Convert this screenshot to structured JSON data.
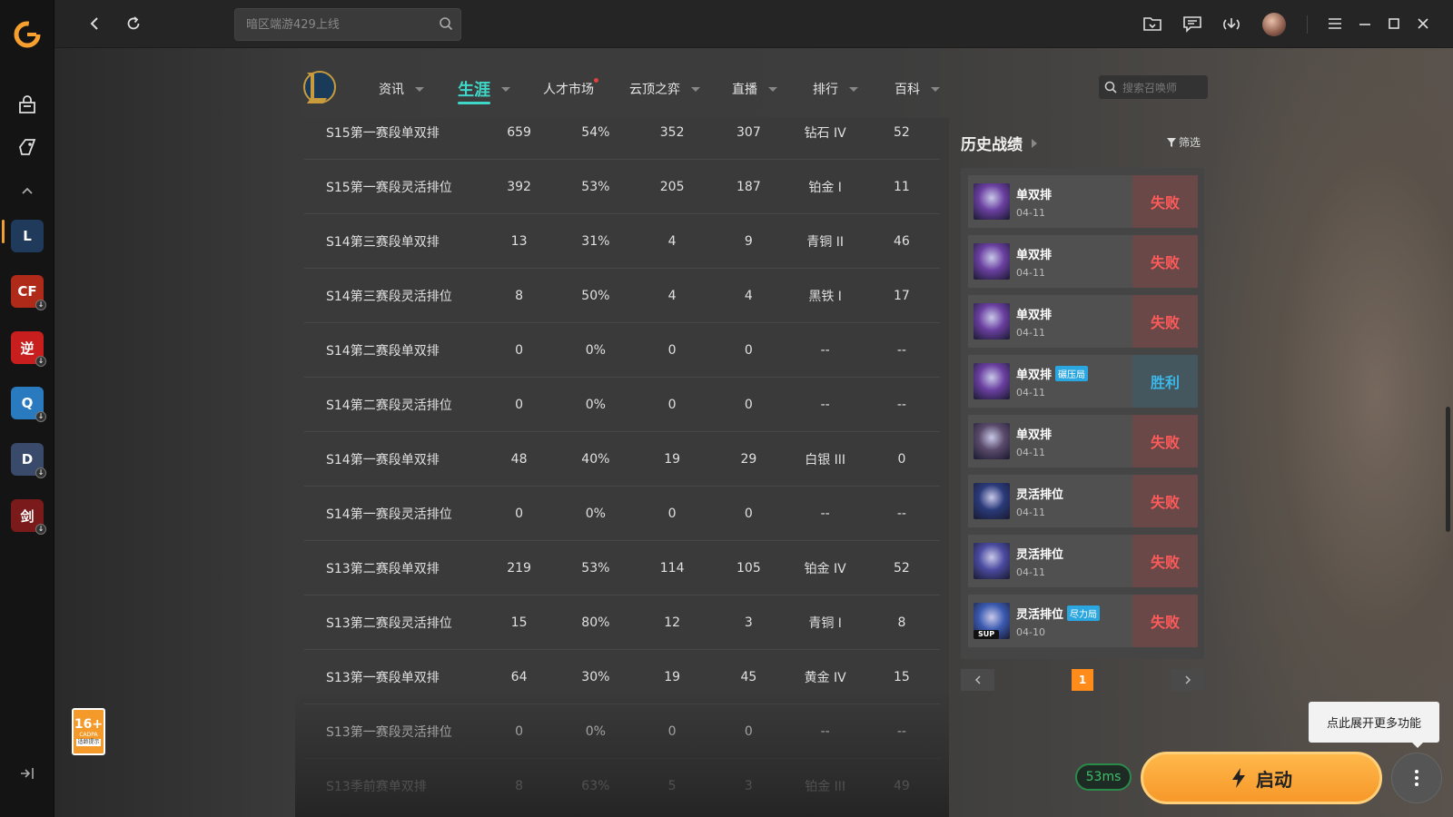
{
  "search": {
    "placeholder": "暗区端游429上线"
  },
  "nav": {
    "items": [
      {
        "label": "资讯"
      },
      {
        "label": "生涯"
      },
      {
        "label": "人才市场"
      },
      {
        "label": "云顶之弈"
      },
      {
        "label": "直播"
      },
      {
        "label": "排行"
      },
      {
        "label": "百科"
      }
    ],
    "summoner_placeholder": "搜索召唤师"
  },
  "stats_rows": [
    {
      "season": "S15第一赛段单双排",
      "games": "659",
      "winrate": "54%",
      "wins": "352",
      "losses": "307",
      "rank": "钻石 IV",
      "lp": "52"
    },
    {
      "season": "S15第一赛段灵活排位",
      "games": "392",
      "winrate": "53%",
      "wins": "205",
      "losses": "187",
      "rank": "铂金 I",
      "lp": "11"
    },
    {
      "season": "S14第三赛段单双排",
      "games": "13",
      "winrate": "31%",
      "wins": "4",
      "losses": "9",
      "rank": "青铜 II",
      "lp": "46"
    },
    {
      "season": "S14第三赛段灵活排位",
      "games": "8",
      "winrate": "50%",
      "wins": "4",
      "losses": "4",
      "rank": "黑铁 I",
      "lp": "17"
    },
    {
      "season": "S14第二赛段单双排",
      "games": "0",
      "winrate": "0%",
      "wins": "0",
      "losses": "0",
      "rank": "--",
      "lp": "--"
    },
    {
      "season": "S14第二赛段灵活排位",
      "games": "0",
      "winrate": "0%",
      "wins": "0",
      "losses": "0",
      "rank": "--",
      "lp": "--"
    },
    {
      "season": "S14第一赛段单双排",
      "games": "48",
      "winrate": "40%",
      "wins": "19",
      "losses": "29",
      "rank": "白银 III",
      "lp": "0"
    },
    {
      "season": "S14第一赛段灵活排位",
      "games": "0",
      "winrate": "0%",
      "wins": "0",
      "losses": "0",
      "rank": "--",
      "lp": "--"
    },
    {
      "season": "S13第二赛段单双排",
      "games": "219",
      "winrate": "53%",
      "wins": "114",
      "losses": "105",
      "rank": "铂金 IV",
      "lp": "52"
    },
    {
      "season": "S13第二赛段灵活排位",
      "games": "15",
      "winrate": "80%",
      "wins": "12",
      "losses": "3",
      "rank": "青铜 I",
      "lp": "8"
    },
    {
      "season": "S13第一赛段单双排",
      "games": "64",
      "winrate": "30%",
      "wins": "19",
      "losses": "45",
      "rank": "黄金 IV",
      "lp": "15"
    },
    {
      "season": "S13第一赛段灵活排位",
      "games": "0",
      "winrate": "0%",
      "wins": "0",
      "losses": "0",
      "rank": "--",
      "lp": "--"
    },
    {
      "season": "S13季前赛单双排",
      "games": "8",
      "winrate": "63%",
      "wins": "5",
      "losses": "3",
      "rank": "铂金 III",
      "lp": "49"
    }
  ],
  "history": {
    "title": "历史战绩",
    "filter_label": "筛选",
    "matches": [
      {
        "mode": "单双排",
        "tag": "",
        "date": "04-11",
        "result": "失败",
        "outcome": "lose",
        "champ_color": "#6a3fa0",
        "support": ""
      },
      {
        "mode": "单双排",
        "tag": "",
        "date": "04-11",
        "result": "失败",
        "outcome": "lose",
        "champ_color": "#6a3fa0",
        "support": ""
      },
      {
        "mode": "单双排",
        "tag": "",
        "date": "04-11",
        "result": "失败",
        "outcome": "lose",
        "champ_color": "#6a3fa0",
        "support": ""
      },
      {
        "mode": "单双排",
        "tag": "碾压局",
        "date": "04-11",
        "result": "胜利",
        "outcome": "win",
        "champ_color": "#6a3fa0",
        "support": ""
      },
      {
        "mode": "单双排",
        "tag": "",
        "date": "04-11",
        "result": "失败",
        "outcome": "lose",
        "champ_color": "#5a4a6a",
        "support": ""
      },
      {
        "mode": "灵活排位",
        "tag": "",
        "date": "04-11",
        "result": "失败",
        "outcome": "lose",
        "champ_color": "#2a3a7a",
        "support": ""
      },
      {
        "mode": "灵活排位",
        "tag": "",
        "date": "04-11",
        "result": "失败",
        "outcome": "lose",
        "champ_color": "#4a4aa0",
        "support": ""
      },
      {
        "mode": "灵活排位",
        "tag": "尽力局",
        "date": "04-10",
        "result": "失败",
        "outcome": "lose",
        "champ_color": "#3a5ab0",
        "support": "SUP"
      }
    ],
    "pagination": {
      "current": "1"
    }
  },
  "age_rating": {
    "age": "16+",
    "sub": "CADPA",
    "note": "适龄提示"
  },
  "tooltip": "点此展开更多功能",
  "ping": "53ms",
  "launch_label": "启动",
  "sidebar": {
    "games": [
      {
        "name": "英雄联盟",
        "glyph": "L",
        "color": "#1f3a5a"
      },
      {
        "name": "穿越火线",
        "glyph": "CF",
        "color": "#b02a1a"
      },
      {
        "name": "逆战",
        "glyph": "逆",
        "color": "#c81e1e"
      },
      {
        "name": "QQ飞车",
        "glyph": "Q",
        "color": "#2a7ac0"
      },
      {
        "name": "DNF",
        "glyph": "D",
        "color": "#3a4a6a"
      },
      {
        "name": "剑灵",
        "glyph": "剑",
        "color": "#7a1a1a"
      }
    ]
  },
  "colors": {
    "accent": "#3fd8c8",
    "lose": "#ff5a5a",
    "win": "#3bb7e8",
    "launch": "#f7982a"
  }
}
